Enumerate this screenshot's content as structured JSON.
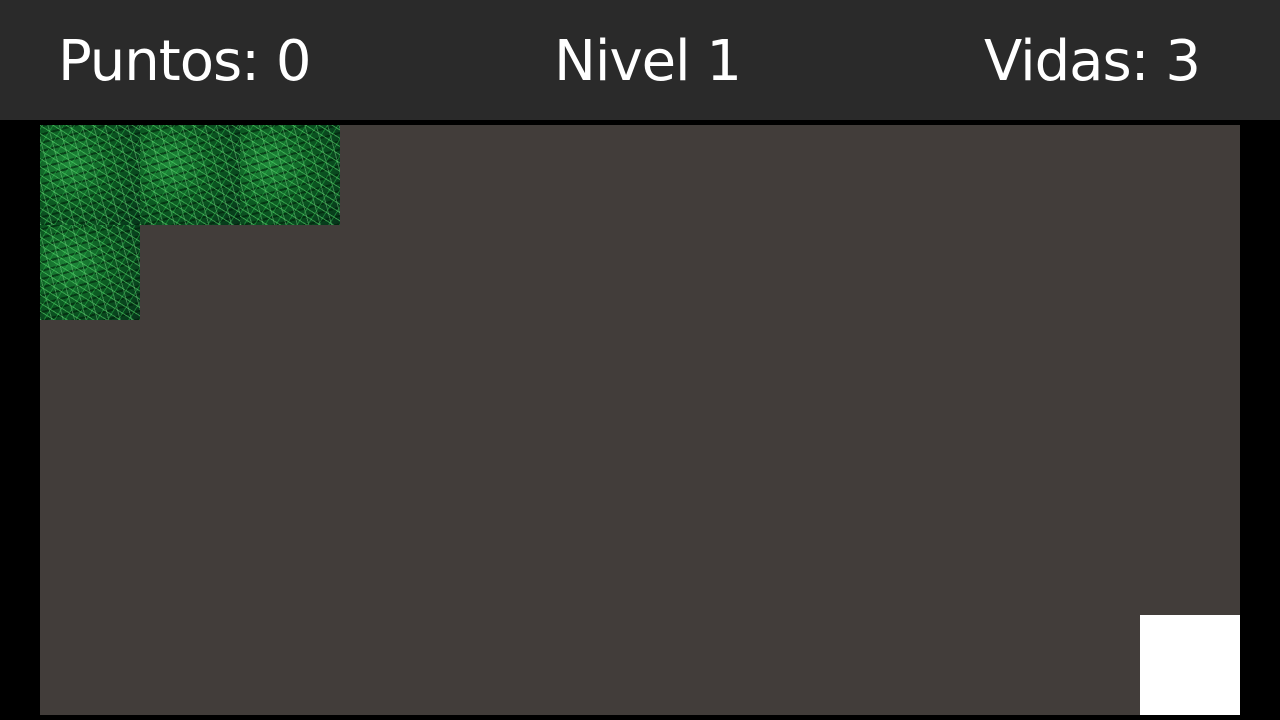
{
  "hud": {
    "score_label": "Puntos:",
    "score_value": "0",
    "level_label": "Nivel",
    "level_value": "1",
    "lives_label": "Vidas:",
    "lives_value": "3"
  },
  "board": {
    "tiles": [
      "grass",
      "grass",
      "grass",
      "grass"
    ],
    "goal": "white-block"
  },
  "colors": {
    "hud_background": "#2a2a2a",
    "board_background": "#423d3a",
    "page_background": "#000000",
    "text": "#ffffff",
    "goal": "#ffffff"
  }
}
